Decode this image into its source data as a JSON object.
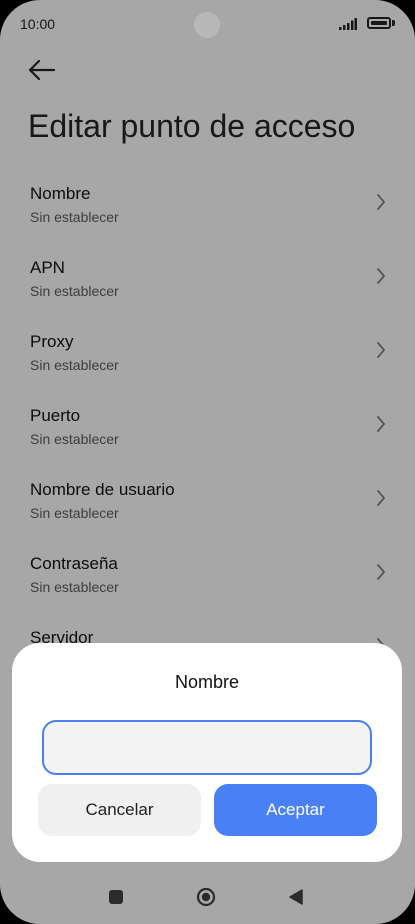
{
  "status_bar": {
    "time": "10:00",
    "icons": [
      "signal-icon",
      "battery-icon"
    ]
  },
  "header": {
    "back_icon": "arrow-left-icon",
    "title": "Editar punto de acceso"
  },
  "settings": {
    "items": [
      {
        "title": "Nombre",
        "value": "Sin establecer"
      },
      {
        "title": "APN",
        "value": "Sin establecer"
      },
      {
        "title": "Proxy",
        "value": "Sin establecer"
      },
      {
        "title": "Puerto",
        "value": "Sin establecer"
      },
      {
        "title": "Nombre de usuario",
        "value": "Sin establecer"
      },
      {
        "title": "Contraseña",
        "value": "Sin establecer"
      },
      {
        "title": "Servidor",
        "value": ""
      }
    ]
  },
  "dialog": {
    "title": "Nombre",
    "input_value": "",
    "cancel_label": "Cancelar",
    "accept_label": "Aceptar"
  },
  "nav_bar": {
    "icons": [
      "recents-square-icon",
      "home-circle-icon",
      "back-triangle-icon"
    ]
  },
  "colors": {
    "accent": "#4a80f5",
    "background": "#e8e8e8",
    "dialog": "#ffffff"
  }
}
